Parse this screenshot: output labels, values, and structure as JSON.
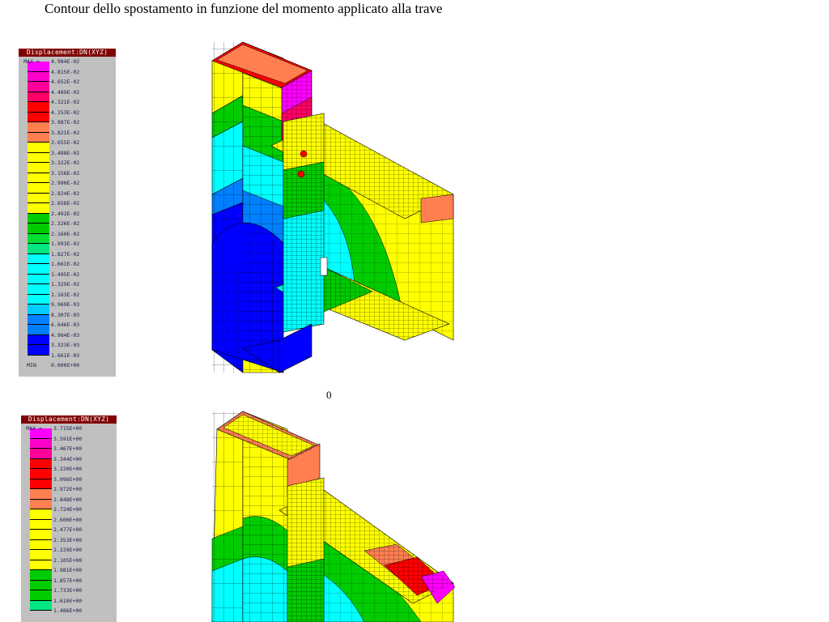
{
  "title": "Contour dello spostamento in funzione del momento applicato alla trave",
  "caption": "0",
  "legends": [
    {
      "header": "Displacement:DN(XYZ)",
      "max_tag": "MAX =",
      "min_tag": "MIN",
      "max_value": "4.984E-02",
      "min_value": "0.000E+00",
      "values": [
        "4.815E-02",
        "4.652E-02",
        "4.489E-02",
        "4.321E-02",
        "4.153E-02",
        "3.987E-02",
        "3.821E-02",
        "3.655E-02",
        "3.488E-02",
        "3.322E-02",
        "3.156E-02",
        "2.990E-02",
        "2.824E-02",
        "2.658E-02",
        "2.492E-02",
        "2.326E-02",
        "2.160E-02",
        "1.993E-02",
        "1.827E-02",
        "1.661E-02",
        "1.495E-02",
        "1.329E-02",
        "1.163E-02",
        "9.969E-03",
        "8.307E-03",
        "6.646E-03",
        "4.984E-03",
        "3.323E-03",
        "1.661E-03"
      ],
      "colors": [
        "#ff00ff",
        "#ff00cc",
        "#ff0099",
        "#ff0066",
        "#ff0000",
        "#ff0000",
        "#ff7f50",
        "#ff7f50",
        "#ffff00",
        "#ffff00",
        "#ffff00",
        "#ffff00",
        "#ffff00",
        "#ffff00",
        "#ffff00",
        "#00cc00",
        "#00cc00",
        "#00dd33",
        "#00e680",
        "#00ffff",
        "#00ffff",
        "#00ffff",
        "#00ffff",
        "#00ffff",
        "#00ccff",
        "#0080ff",
        "#0080ff",
        "#0000ff",
        "#0000ff"
      ]
    },
    {
      "header": "Displacement:DN(XYZ)",
      "max_tag": "MAX =",
      "max_value": "3.715E+00",
      "values": [
        "3.591E+00",
        "3.467E+00",
        "3.344E+00",
        "3.220E+00",
        "3.096E+00",
        "2.972E+00",
        "2.848E+00",
        "2.724E+00",
        "2.600E+00",
        "2.477E+00",
        "2.353E+00",
        "2.229E+00",
        "2.105E+00",
        "1.981E+00",
        "1.857E+00",
        "1.733E+00",
        "1.610E+00",
        "1.486E+00"
      ],
      "colors": [
        "#ff00ff",
        "#ff00cc",
        "#ff0099",
        "#ff0000",
        "#ff0000",
        "#ff0000",
        "#ff7f50",
        "#ff7f50",
        "#ffff00",
        "#ffff00",
        "#ffff00",
        "#ffff00",
        "#ffff00",
        "#ffff00",
        "#00cc00",
        "#00cc00",
        "#00cc00",
        "#00e680"
      ]
    }
  ],
  "fem_colors": {
    "blue": "#0000ff",
    "mid_blue": "#0080ff",
    "cyan": "#00ffff",
    "green": "#00cc00",
    "yellow": "#ffff00",
    "orange": "#ff7f50",
    "red": "#ff0000",
    "magenta": "#ff00ff"
  }
}
